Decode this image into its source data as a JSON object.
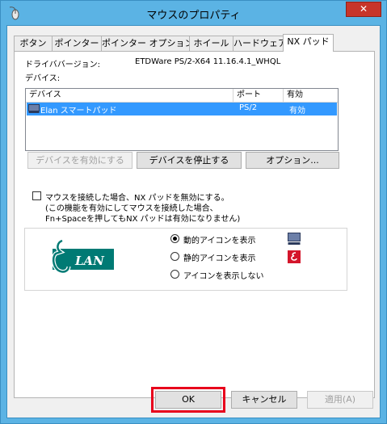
{
  "window": {
    "title": "マウスのプロパティ",
    "close_glyph": "✕"
  },
  "tabs": [
    {
      "label": "ボタン",
      "active": false
    },
    {
      "label": "ポインター",
      "active": false
    },
    {
      "label": "ポインター オプション",
      "active": false
    },
    {
      "label": "ホイール",
      "active": false
    },
    {
      "label": "ハードウェア",
      "active": false
    },
    {
      "label": "NX パッド",
      "active": true
    }
  ],
  "driver": {
    "label": "ドライババージョン:",
    "value": "ETDWare PS/2-X64 11.16.4.1_WHQL"
  },
  "devices_label": "デバイス:",
  "device_list": {
    "columns": [
      "デバイス",
      "ポート",
      "有効"
    ],
    "rows": [
      {
        "device": "Elan スマートパッド",
        "port": "PS/2",
        "enabled": "有効"
      }
    ]
  },
  "buttons": {
    "enable": "デバイスを有効にする",
    "disable": "デバイスを停止する",
    "options": "オプション..."
  },
  "disable_on_mouse": {
    "line1": "マウスを接続した場合、NX パッドを無効にする。",
    "line2": "(この機能を有効にしてマウスを接続した場合、",
    "line3": "Fn+Spaceを押してもNX パッドは有効になりません)"
  },
  "logo_text": "LAN",
  "icon_options": [
    {
      "label": "動的アイコンを表示",
      "checked": true,
      "icon": "monitor-icon"
    },
    {
      "label": "静的アイコンを表示",
      "checked": false,
      "icon": "elan-red-icon"
    },
    {
      "label": "アイコンを表示しない",
      "checked": false
    }
  ],
  "footer": {
    "ok": "OK",
    "cancel": "キャンセル",
    "apply": "適用(A)"
  },
  "colors": {
    "accent": "#3399ff",
    "highlight": "#e8001c",
    "logo": "#007a74"
  }
}
